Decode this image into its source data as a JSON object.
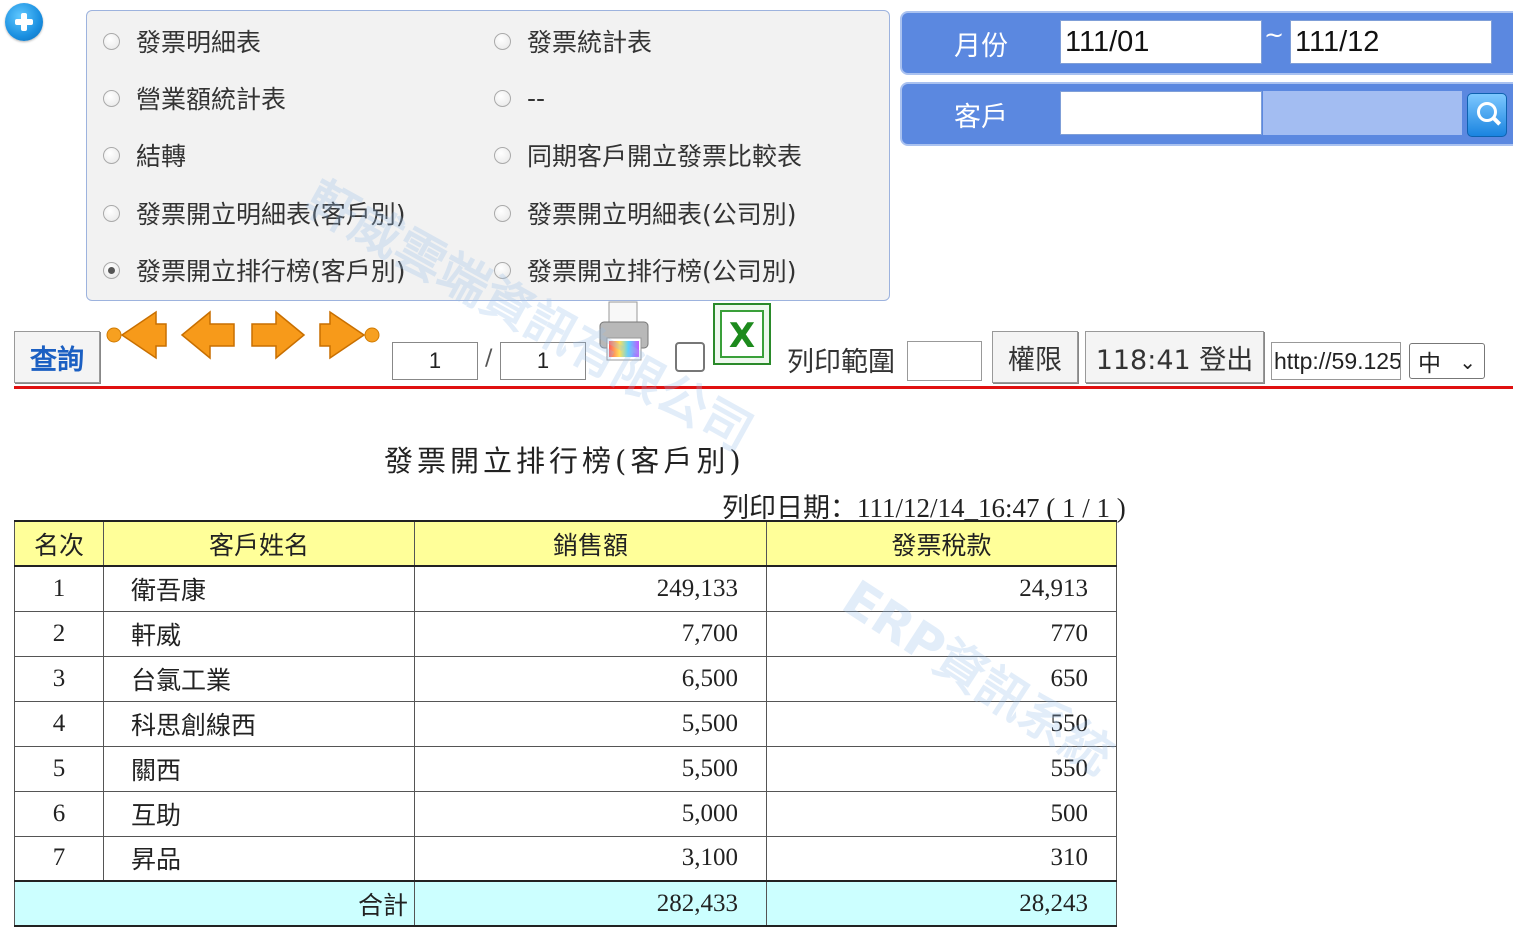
{
  "report_options": [
    {
      "label": "發票明細表",
      "checked": false
    },
    {
      "label": "發票統計表",
      "checked": false
    },
    {
      "label": "營業額統計表",
      "checked": false
    },
    {
      "label": "--",
      "checked": false
    },
    {
      "label": "結轉",
      "checked": false
    },
    {
      "label": "同期客戶開立發票比較表",
      "checked": false
    },
    {
      "label": "發票開立明細表(客戶別)",
      "checked": false
    },
    {
      "label": "發票開立明細表(公司別)",
      "checked": false
    },
    {
      "label": "發票開立排行榜(客戶別)",
      "checked": true
    },
    {
      "label": "發票開立排行榜(公司別)",
      "checked": false
    }
  ],
  "filters": {
    "month_label": "月份",
    "month_from": "111/01",
    "tilde": "~",
    "month_to": "111/12",
    "customer_label": "客戶",
    "customer_code": "",
    "customer_name": ""
  },
  "toolbar": {
    "query_label": "查詢",
    "page_current": "1",
    "page_separator": "/",
    "page_total": "1",
    "print_range_label": "列印範圍",
    "print_range_value": "",
    "permission_label": "權限",
    "logout_label": "118:41 登出",
    "url_value": "http://59.125",
    "language": "中"
  },
  "report": {
    "title": "發票開立排行榜(客戶別)",
    "print_date": "列印日期：111/12/14_16:47 ( 1 / 1 )",
    "columns": [
      "名次",
      "客戶姓名",
      "銷售額",
      "發票稅款"
    ],
    "rows": [
      {
        "rank": "1",
        "name": "衛吾康",
        "sales": "249,133",
        "tax": "24,913"
      },
      {
        "rank": "2",
        "name": "軒威",
        "sales": "7,700",
        "tax": "770"
      },
      {
        "rank": "3",
        "name": "台氯工業",
        "sales": "6,500",
        "tax": "650"
      },
      {
        "rank": "4",
        "name": "科思創線西",
        "sales": "5,500",
        "tax": "550"
      },
      {
        "rank": "5",
        "name": "關西",
        "sales": "5,500",
        "tax": "550"
      },
      {
        "rank": "6",
        "name": "互助",
        "sales": "5,000",
        "tax": "500"
      },
      {
        "rank": "7",
        "name": "昇品",
        "sales": "3,100",
        "tax": "310"
      }
    ],
    "total_label": "合計",
    "total_sales": "282,433",
    "total_tax": "28,243"
  },
  "watermark": {
    "line1": "軒威雲端資訊有限公司",
    "line2": "ERP資訊系統"
  },
  "colors": {
    "filter_panel": "#5b88e0",
    "header_row": "#ffff99",
    "total_row": "#ccffff",
    "divider": "#e01010",
    "query_text": "#1b5fc2"
  }
}
